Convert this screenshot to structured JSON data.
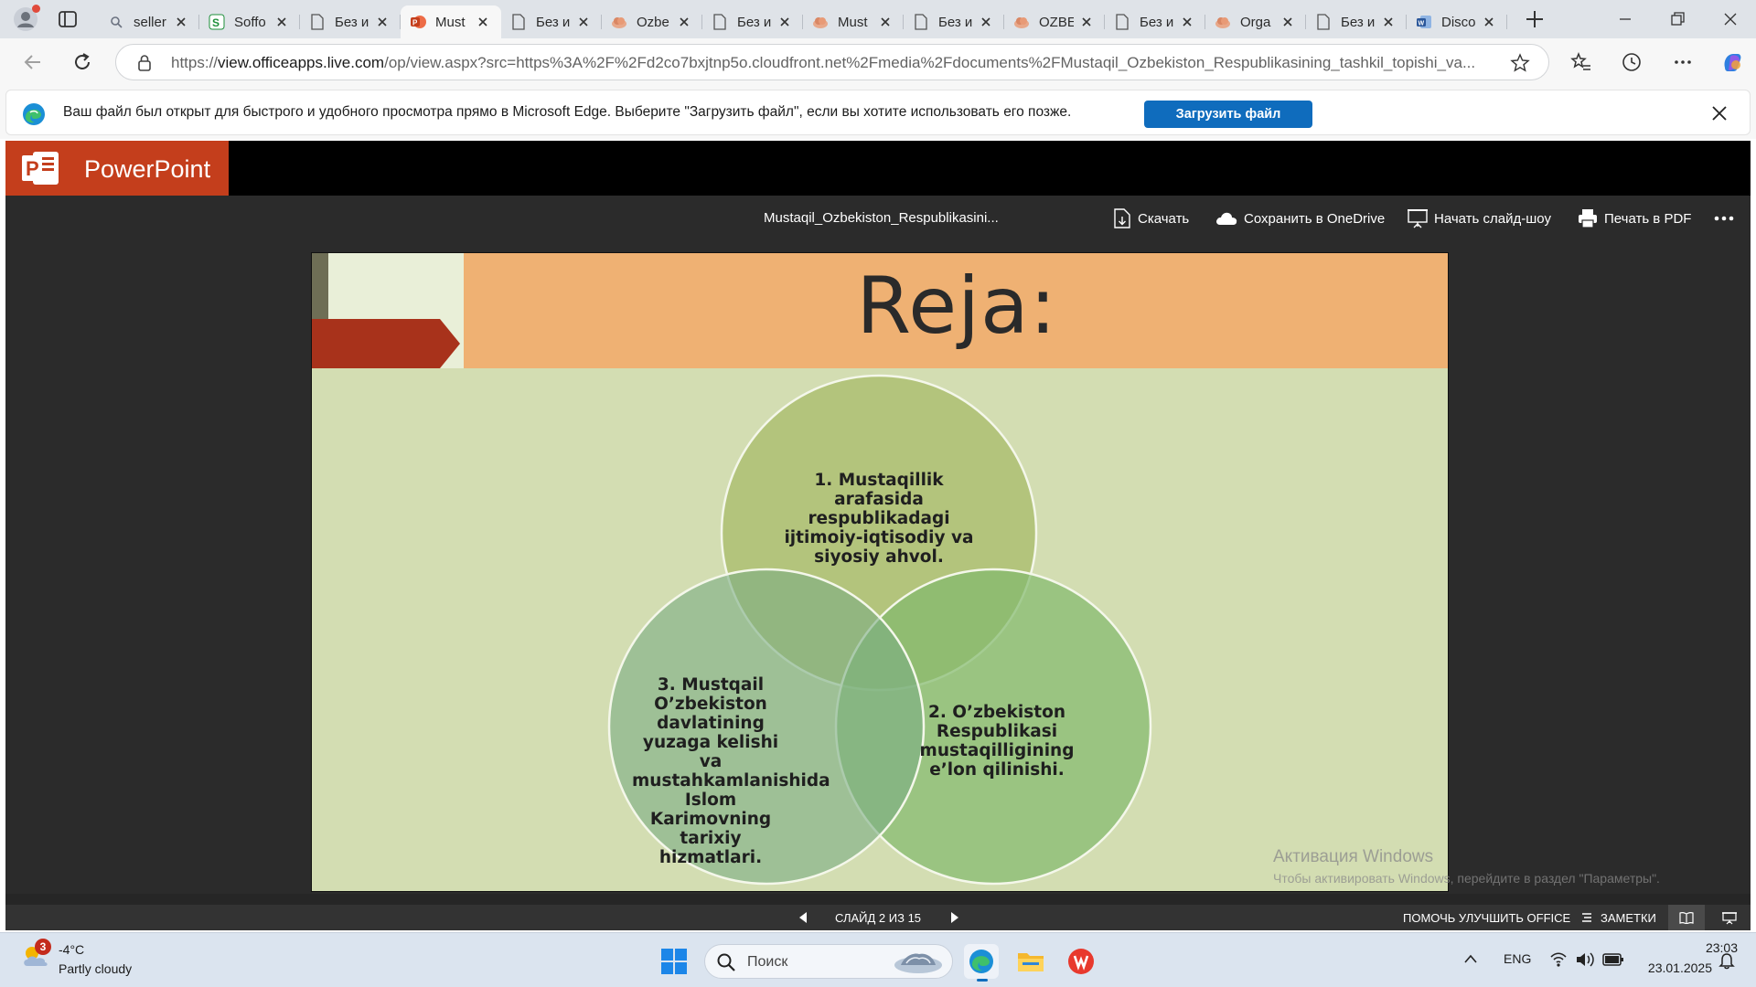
{
  "browser": {
    "tabs": [
      {
        "title": "seller",
        "icon": "search-icon"
      },
      {
        "title": "Soffo",
        "icon": "soff-icon"
      },
      {
        "title": "Без и",
        "icon": "document-icon"
      },
      {
        "title": "Must",
        "icon": "powerpoint-icon",
        "active": true
      },
      {
        "title": "Без и",
        "icon": "document-icon"
      },
      {
        "title": "Ozbe",
        "icon": "ppt-cloud-icon"
      },
      {
        "title": "Без и",
        "icon": "document-icon"
      },
      {
        "title": "Must",
        "icon": "ppt-cloud-icon"
      },
      {
        "title": "Без и",
        "icon": "document-icon"
      },
      {
        "title": "OZBE",
        "icon": "ppt-cloud-icon"
      },
      {
        "title": "Без и",
        "icon": "document-icon"
      },
      {
        "title": "Orga",
        "icon": "ppt-cloud-icon"
      },
      {
        "title": "Без и",
        "icon": "document-icon"
      },
      {
        "title": "Disco",
        "icon": "word-icon"
      }
    ],
    "url_prefix": "https://",
    "url_host": "view.officeapps.live.com",
    "url_rest": "/op/view.aspx?src=https%3A%2F%2Fd2co7bxjtnp5o.cloudfront.net%2Fmedia%2Fdocuments%2FMustaqil_Ozbekiston_Respublikasining_tashkil_topishi_va..."
  },
  "infobar": {
    "message": "Ваш файл был открыт для быстрого и удобного просмотра прямо в Microsoft Edge. Выберите \"Загрузить файл\", если вы хотите использовать его позже.",
    "button": "Загрузить файл"
  },
  "app": {
    "name": "PowerPoint",
    "doc_title": "Mustaqil_Ozbekiston_Respublikasini...",
    "commands": {
      "download": "Скачать",
      "onedrive": "Сохранить в OneDrive",
      "slideshow": "Начать слайд-шоу",
      "print": "Печать в PDF"
    }
  },
  "slide": {
    "title": "Reja:",
    "items": [
      "1. Mustaqillik arafasida respublikadagi ijtimoiy-iqtisodiy va siyosiy ahvol.",
      "2. O’zbekiston Respublikasi mustaqilligining e’lon qilinishi.",
      "3. Mustqail O’zbekiston davlatining yuzaga kelishi va mustahkamlanishida Islom Karimovning tarixiy hizmatlari."
    ],
    "colors": {
      "title_bar": "#efb173",
      "background": "#d3ddb2",
      "arrow": "#a8321b"
    }
  },
  "watermark": {
    "line1": "Активация Windows",
    "line2": "Чтобы активировать Windows, перейдите в раздел \"Параметры\"."
  },
  "status": {
    "slide_counter": "СЛАЙД 2 ИЗ 15",
    "help_improve": "ПОМОЧЬ УЛУЧШИТЬ OFFICE",
    "notes": "ЗАМЕТКИ"
  },
  "taskbar": {
    "weather_badge": "3",
    "weather_temp": "-4°C",
    "weather_desc": "Partly cloudy",
    "search_placeholder": "Поиск",
    "language": "ENG",
    "time": "23:03",
    "date": "23.01.2025"
  }
}
